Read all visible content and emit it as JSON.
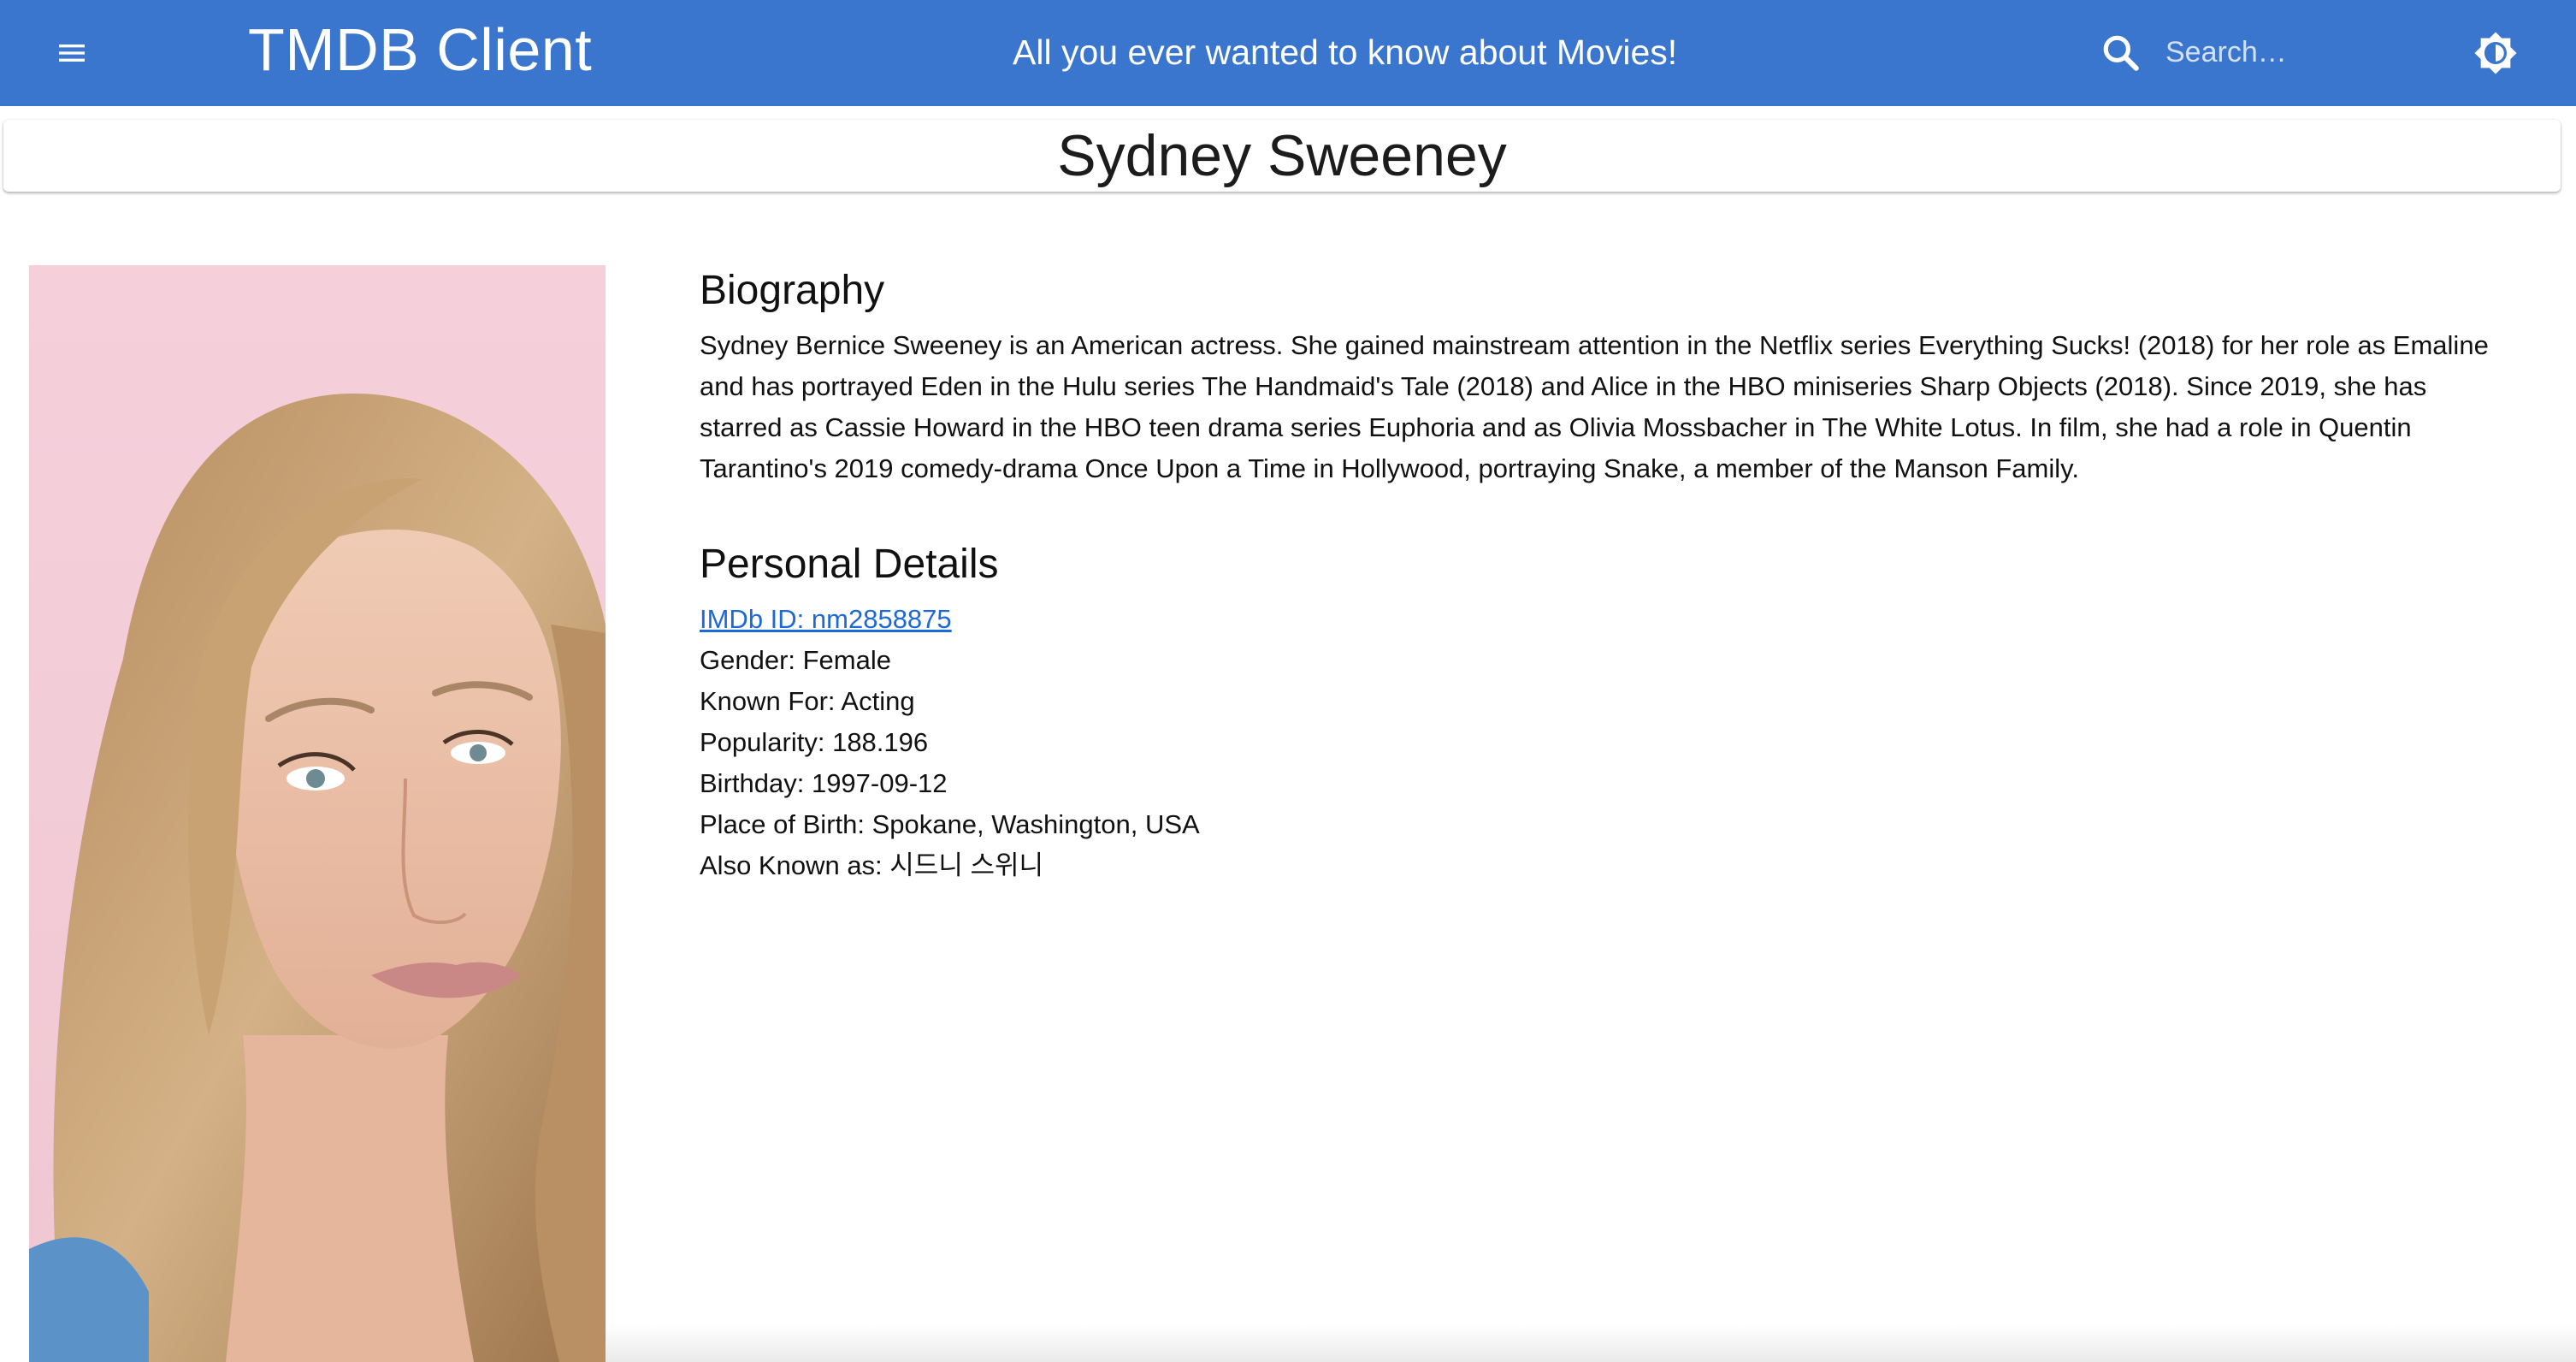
{
  "app": {
    "title": "TMDB Client",
    "tagline": "All you ever wanted to know about Movies!",
    "accent_color": "#3b76ce"
  },
  "toolbar": {
    "menu_icon": "menu-icon",
    "search_icon": "search-icon",
    "search_placeholder": "Search…",
    "search_value": "",
    "theme_icon": "brightness-icon"
  },
  "person": {
    "name": "Sydney Sweeney",
    "photo_alt": "Sydney Sweeney"
  },
  "biography": {
    "heading": "Biography",
    "text": "Sydney Bernice Sweeney is an American actress. She gained mainstream attention in the Netflix series Everything Sucks! (2018) for her role as Emaline and has portrayed Eden in the Hulu series The Handmaid's Tale (2018) and Alice in the HBO miniseries Sharp Objects (2018). Since 2019, she has starred as Cassie Howard in the HBO teen drama series Euphoria and as Olivia Mossbacher in The White Lotus. In film, she had a role in Quentin Tarantino's 2019 comedy-drama Once Upon a Time in Hollywood, portraying Snake, a member of the Manson Family."
  },
  "personal_details": {
    "heading": "Personal Details",
    "imdb": "IMDb ID: nm2858875",
    "gender": "Gender: Female",
    "known_for": "Known For: Acting",
    "popularity": "Popularity: 188.196",
    "birthday": "Birthday: 1997-09-12",
    "place_of_birth": "Place of Birth: Spokane, Washington, USA",
    "also_known_as": "Also Known as: 시드니 스위니"
  }
}
